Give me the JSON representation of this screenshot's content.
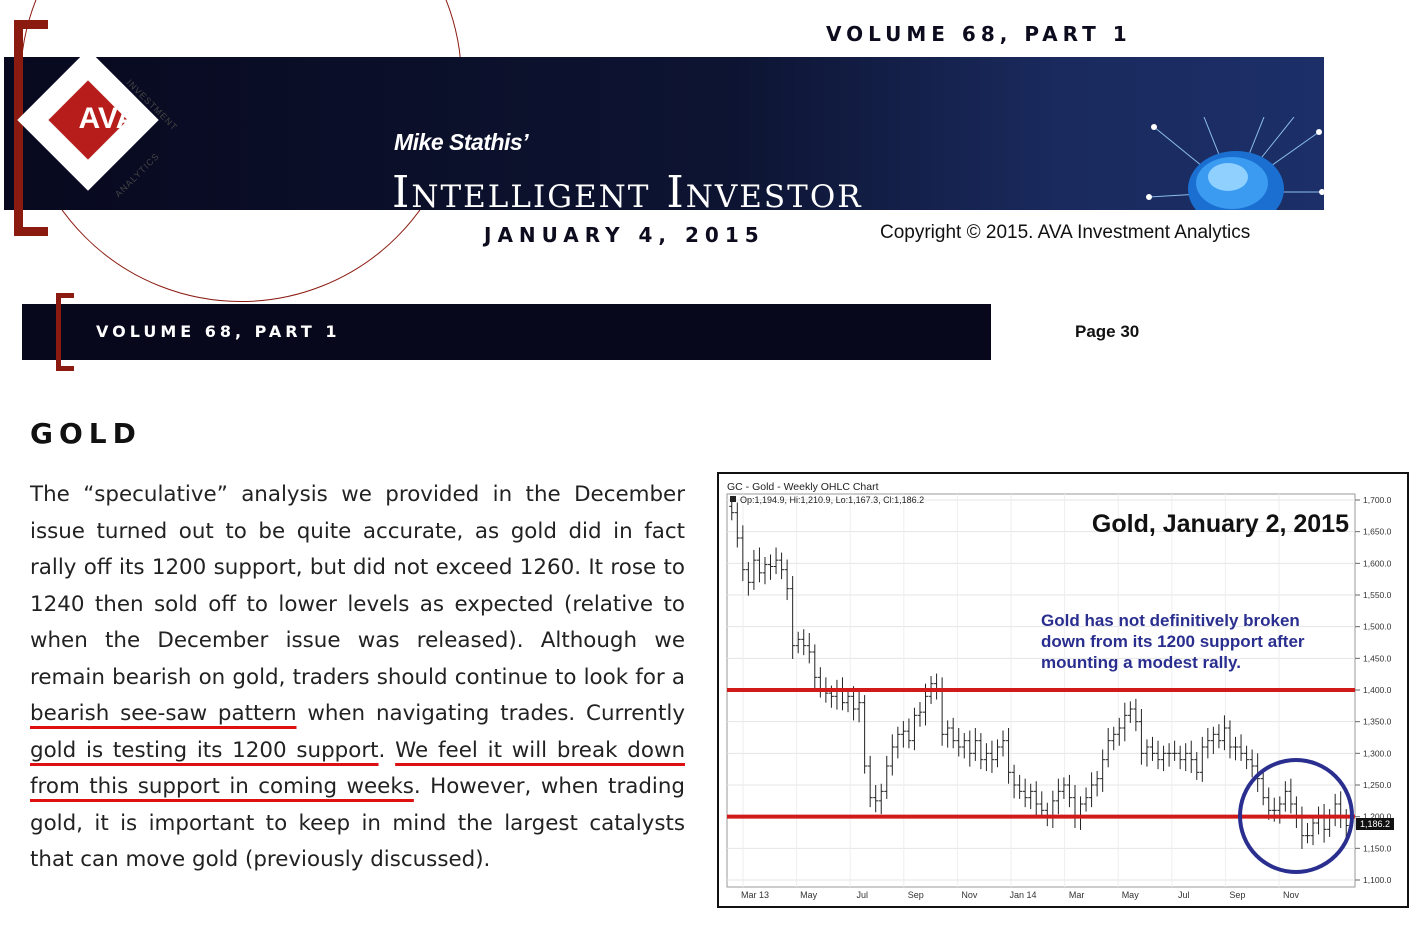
{
  "header": {
    "volume": "VOLUME 68, PART 1",
    "author": "Mike Stathis’",
    "publication": "Intelligent Investor",
    "date": "JANUARY 4, 2015",
    "copyright": "Copyright © 2015. AVA Investment Analytics",
    "logo": {
      "text": "AVA",
      "ring_top": "INVESTMENT",
      "ring_bottom": "ANALYTICS"
    }
  },
  "subbar": {
    "volume": "VOLUME 68, PART 1",
    "page": "Page 30"
  },
  "section": {
    "title": "GOLD"
  },
  "article": {
    "part1": "The “speculative” analysis we provided in the December issue turned out to be quite accurate, as gold did in fact rally off its 1200 support, but did not exceed 1260. It rose to 1240 then sold off to lower levels as expected (relative to when the December issue was released). Although we remain bearish on gold, traders should continue to look for a ",
    "u1": "bearish see-saw pattern",
    "part2": " when navigating trades. Currently ",
    "u2": "gold is testing its 1200 support",
    "part3": ". ",
    "u3": "We feel it will break down from this support in coming weeks",
    "part4": ". However, when trading gold, it is important to keep in mind the largest catalysts that can move gold (previously discussed)."
  },
  "colors": {
    "accent_red": "#d11a1a",
    "bracket": "#8b1a10",
    "navy": "#07081c",
    "annotation_blue": "#2a2f8f"
  },
  "chart_data": {
    "type": "ohlc",
    "title": "GC - Gold - Weekly OHLC Chart",
    "legend": "Op:1,194.9, Hi:1,210.9, Lo:1,167.3, Cl:1,186.2",
    "headline": "Gold, January 2, 2015",
    "annotation": [
      "Gold has not definitively broken",
      "down from its 1200 support after",
      "mounting a modest rally."
    ],
    "last_price": "1,186.2",
    "ylim": [
      1100,
      1700
    ],
    "y_ticks": [
      "1,700.0",
      "1,650.0",
      "1,600.0",
      "1,550.0",
      "1,500.0",
      "1,450.0",
      "1,400.0",
      "1,350.0",
      "1,300.0",
      "1,250.0",
      "1,200.0",
      "1,150.0",
      "1,100.0"
    ],
    "y_tick_values": [
      1700,
      1650,
      1600,
      1550,
      1500,
      1450,
      1400,
      1350,
      1300,
      1250,
      1200,
      1150,
      1100
    ],
    "x_ticks": [
      "Mar 13",
      "May",
      "Jul",
      "Sep",
      "Nov",
      "Jan 14",
      "Mar",
      "May",
      "Jul",
      "Sep",
      "Nov"
    ],
    "horizontal_lines": [
      1400,
      1200
    ],
    "closes": [
      1680,
      1640,
      1590,
      1570,
      1605,
      1585,
      1598,
      1595,
      1605,
      1590,
      1560,
      1470,
      1480,
      1470,
      1460,
      1420,
      1400,
      1395,
      1390,
      1400,
      1380,
      1390,
      1370,
      1380,
      1280,
      1230,
      1225,
      1240,
      1280,
      1310,
      1330,
      1335,
      1320,
      1360,
      1365,
      1390,
      1410,
      1400,
      1330,
      1340,
      1320,
      1310,
      1320,
      1300,
      1320,
      1290,
      1300,
      1290,
      1310,
      1320,
      1270,
      1250,
      1240,
      1230,
      1240,
      1220,
      1210,
      1200,
      1225,
      1240,
      1250,
      1230,
      1200,
      1220,
      1230,
      1250,
      1260,
      1290,
      1320,
      1330,
      1340,
      1360,
      1370,
      1350,
      1300,
      1310,
      1300,
      1290,
      1300,
      1300,
      1300,
      1290,
      1300,
      1290,
      1270,
      1310,
      1320,
      1330,
      1320,
      1340,
      1310,
      1310,
      1300,
      1290,
      1280,
      1260,
      1230,
      1210,
      1210,
      1220,
      1240,
      1220,
      1200,
      1170,
      1170,
      1190,
      1200,
      1180,
      1200,
      1220,
      1200,
      1186
    ]
  }
}
